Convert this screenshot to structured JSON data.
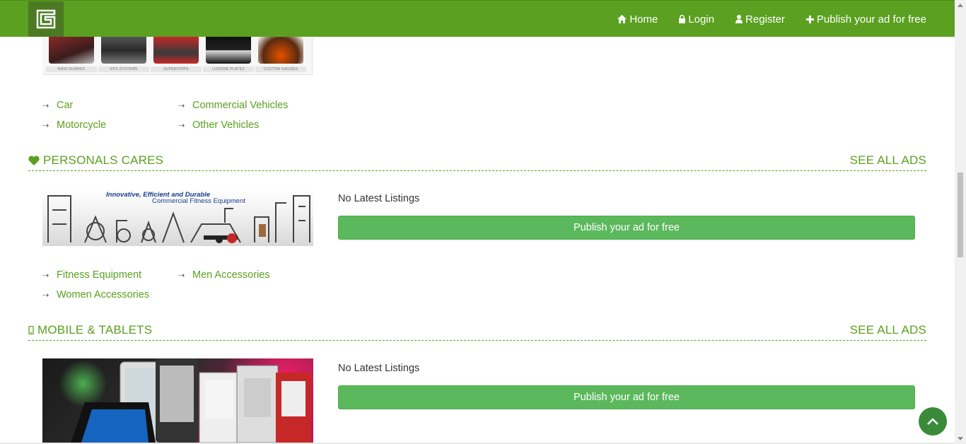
{
  "nav": {
    "home": "Home",
    "login": "Login",
    "register": "Register",
    "publish": "Publish your ad for free"
  },
  "top_banner": {
    "captions": [
      "RAIN GUARDS",
      "GPS SYSTEMS",
      "SUPERCHIPS",
      "LICENSE PLATES",
      "CUSTOM GAUGES"
    ]
  },
  "vehicles_subcats": [
    "Car",
    "Commercial Vehicles",
    "Motorcycle",
    "Other Vehicles"
  ],
  "sections": [
    {
      "title": "PERSONALS CARES",
      "see_all": "SEE ALL ADS",
      "banner_line1": "Innovative, Efficient and Durable",
      "banner_line2": "Commercial Fitness Equipment",
      "no_listings": "No Latest Listings",
      "publish": "Publish your ad for free",
      "subcats": [
        "Fitness Equipment",
        "Men Accessories",
        "Women Accessories"
      ]
    },
    {
      "title": "MOBILE & TABLETS",
      "see_all": "SEE ALL ADS",
      "no_listings": "No Latest Listings",
      "publish": "Publish your ad for free"
    }
  ],
  "colors": {
    "brand_green": "#5ba021",
    "button_green": "#5cb85c",
    "logo_bg": "#4b7a22"
  },
  "icons": {
    "logo": "g-logo-icon",
    "home": "home-icon",
    "login": "lock-icon",
    "register": "user-icon",
    "publish": "plus-icon",
    "personals": "heart-icon",
    "mobile": "mobile-icon",
    "back_to_top": "chevron-up-icon",
    "subcat": "dotted-arrow-icon"
  }
}
